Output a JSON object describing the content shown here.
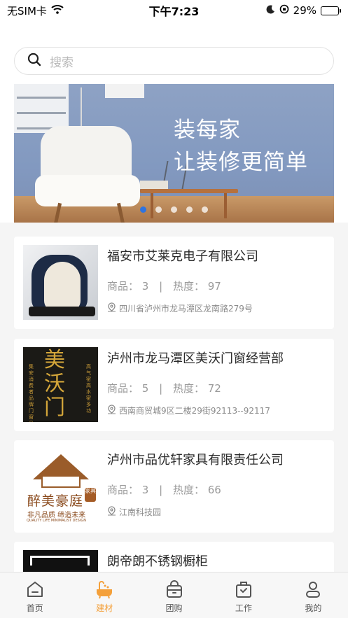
{
  "status_bar": {
    "carrier": "无SIM卡",
    "time": "下午7:23",
    "battery": "29%"
  },
  "search": {
    "placeholder": "搜索"
  },
  "banner": {
    "title": "装每家",
    "subtitle": "让装修更简单",
    "dot_count": 5,
    "active_dot": 0
  },
  "stores": [
    {
      "name": "福安市艾莱克电子有限公司",
      "goods_label": "商品：",
      "goods": "3",
      "heat_label": "热度：",
      "heat": "97",
      "address": "四川省泸州市龙马潭区龙南路279号",
      "thumb_icon": "massage-chair-image"
    },
    {
      "name": "泸州市龙马潭区美沃门窗经营部",
      "goods_label": "商品：",
      "goods": "5",
      "heat_label": "热度：",
      "heat": "72",
      "address": "西南商贸城9区二楼29街92113--92117",
      "thumb_icon": "door-window-poster"
    },
    {
      "name": "泸州市品优轩家具有限责任公司",
      "goods_label": "商品：",
      "goods": "3",
      "heat_label": "热度：",
      "heat": "66",
      "address": "江南科技园",
      "thumb_icon": "furniture-logo"
    },
    {
      "name": "朗帝朗不锈钢橱柜",
      "thumb_icon": "steel-logo"
    }
  ],
  "thumb_text": {
    "door_main": "美沃门",
    "door_left": "集安消费者品牌门窗品",
    "door_right": "高气密高水密多功",
    "logo_cn": "醉美豪庭",
    "logo_stamp": "家具",
    "logo_slogan": "非凡品质 缔造未来",
    "logo_en": "QUALITY LIFE MINIMALIST DESIGN"
  },
  "separator": "|",
  "tabs": [
    {
      "label": "首页",
      "icon": "home-icon",
      "active": false
    },
    {
      "label": "建材",
      "icon": "bathtub-icon",
      "active": true
    },
    {
      "label": "团购",
      "icon": "shopping-bag-icon",
      "active": false
    },
    {
      "label": "工作",
      "icon": "briefcase-icon",
      "active": false
    },
    {
      "label": "我的",
      "icon": "user-icon",
      "active": false
    }
  ],
  "colors": {
    "accent": "#f4a03a",
    "dot_active": "#2f74e0",
    "battery": "#3cc44a"
  }
}
